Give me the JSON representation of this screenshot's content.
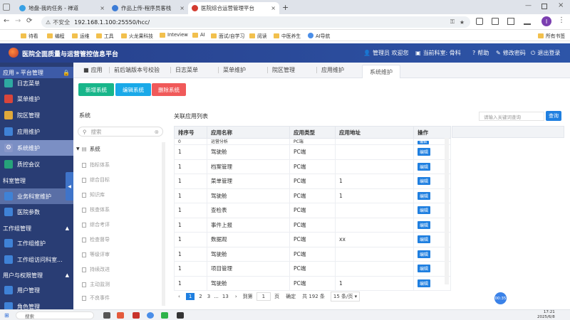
{
  "browser": {
    "tabs": [
      {
        "title": "地盘-我的任务 - 禅道",
        "active": false,
        "color": "#37a0e4"
      },
      {
        "title": "作品上传-程序员客栈",
        "active": false,
        "color": "#3b7bd6"
      },
      {
        "title": "医院综合运营管理平台",
        "active": true,
        "color": "#d33b2f"
      }
    ],
    "new_tab": "+",
    "url_prefix": "不安全",
    "url": "192.168.1.100:25550/hcc/",
    "avatar_letter": "I"
  },
  "bookmarks": [
    "待看",
    "编程",
    "运维",
    "工具",
    "火龙果科技",
    "Inteview",
    "AI",
    "面试/自学习",
    "阅读",
    "中医养生",
    "AI导航"
  ],
  "bookmarks_right": "所有书签",
  "app": {
    "title": "医院全面质量与运营管控信息平台",
    "header_items": [
      "管理员 欢迎您",
      "当前科室: 骨科",
      "帮助",
      "修改密码",
      "退出登录"
    ]
  },
  "sidebar": {
    "section_top": "应用",
    "section_top_sub": "平台管理",
    "items": [
      {
        "label": "日志菜单",
        "icon": "list-icon",
        "color": "#2ea8a1"
      },
      {
        "label": "菜单维护",
        "icon": "menu-icon",
        "color": "#d9453b"
      },
      {
        "label": "院区管理",
        "icon": "hospital-icon",
        "color": "#e0a93a"
      },
      {
        "label": "应用维护",
        "icon": "app-icon",
        "color": "#3f82d6"
      },
      {
        "label": "系统维护",
        "icon": "gear-icon",
        "color": "#8a98c9",
        "selected": true
      },
      {
        "label": "质控会议",
        "icon": "meeting-icon",
        "color": "#26a37a"
      }
    ],
    "section2": "科室管理",
    "items2": [
      {
        "label": "业务科室维护",
        "icon": "grid-icon",
        "color": "#3f82d6"
      },
      {
        "label": "医院参数",
        "icon": "printer-icon",
        "color": "#3f82d6"
      }
    ],
    "section3": "工作组管理",
    "items3": [
      {
        "label": "工作组维护",
        "icon": "user-icon",
        "color": "#3f82d6"
      },
      {
        "label": "工作组访问科室...",
        "icon": "gear-icon",
        "color": "#3f82d6"
      }
    ],
    "section4": "用户与权限管理",
    "items4": [
      {
        "label": "用户管理",
        "icon": "user-icon",
        "color": "#3f82d6"
      },
      {
        "label": "角色管理",
        "icon": "role-icon",
        "color": "#3f82d6"
      }
    ]
  },
  "content_tabs": [
    "应用",
    "前后端版本号校验",
    "日志菜单",
    "菜单维护",
    "院区管理",
    "应用维护",
    "系统维护"
  ],
  "buttons": {
    "add": "新增系统",
    "edit": "编辑系统",
    "delete": "删除系统"
  },
  "left_panel": {
    "title": "系统",
    "search_placeholder": "搜索",
    "root": "系统",
    "items": [
      "指标体系",
      "综合目标",
      "知识库",
      "核查体系",
      "综合考评",
      "检查督导",
      "等级评审",
      "持续改进",
      "主动监测",
      "不良事件"
    ]
  },
  "right_panel": {
    "title": "关联应用列表",
    "search_placeholder": "请输入关键词查询",
    "search_button": "查询",
    "columns": [
      "排序号",
      "应用名称",
      "应用类型",
      "应用地址",
      "操作"
    ],
    "partial_row": {
      "seq": "0",
      "name": "运营分析",
      "type": "PC端",
      "edit": "编辑"
    },
    "rows": [
      {
        "seq": "1",
        "name": "驾驶舱",
        "type": "PC端",
        "url": "",
        "edit": "编辑"
      },
      {
        "seq": "1",
        "name": "档案管理",
        "type": "PC端",
        "url": "",
        "edit": "编辑"
      },
      {
        "seq": "1",
        "name": "菜单管理",
        "type": "PC端",
        "url": "1",
        "edit": "编辑"
      },
      {
        "seq": "1",
        "name": "驾驶舱",
        "type": "PC端",
        "url": "1",
        "edit": "编辑"
      },
      {
        "seq": "1",
        "name": "查检表",
        "type": "PC端",
        "url": "",
        "edit": "编辑"
      },
      {
        "seq": "1",
        "name": "事件上报",
        "type": "PC端",
        "url": "",
        "edit": "编辑"
      },
      {
        "seq": "1",
        "name": "数据观",
        "type": "PC端",
        "url": "xx",
        "edit": "编辑"
      },
      {
        "seq": "1",
        "name": "驾驶舱",
        "type": "PC端",
        "url": "",
        "edit": "编辑"
      },
      {
        "seq": "1",
        "name": "项目管理",
        "type": "PC端",
        "url": "",
        "edit": "编辑"
      },
      {
        "seq": "1",
        "name": "驾驶舱",
        "type": "PC端",
        "url": "1",
        "edit": "编辑"
      }
    ],
    "pagination": {
      "current": "1",
      "pages": [
        "2",
        "3",
        "...",
        "13"
      ],
      "goto_label": "到第",
      "goto_value": "1",
      "page_unit": "页",
      "confirm": "确定",
      "total": "共 192 条",
      "page_size": "15 条/页"
    }
  },
  "floating_badge": "00:35",
  "taskbar": {
    "search": "搜索",
    "time": "17:21",
    "date": "2025/6/8"
  },
  "colors": {
    "header": "#2b4c9c",
    "sidebar": "#293d74",
    "btn_green": "#18b68a",
    "btn_blue": "#1aa9e8",
    "btn_red": "#f05a5a",
    "edit": "#1f7fe0"
  }
}
